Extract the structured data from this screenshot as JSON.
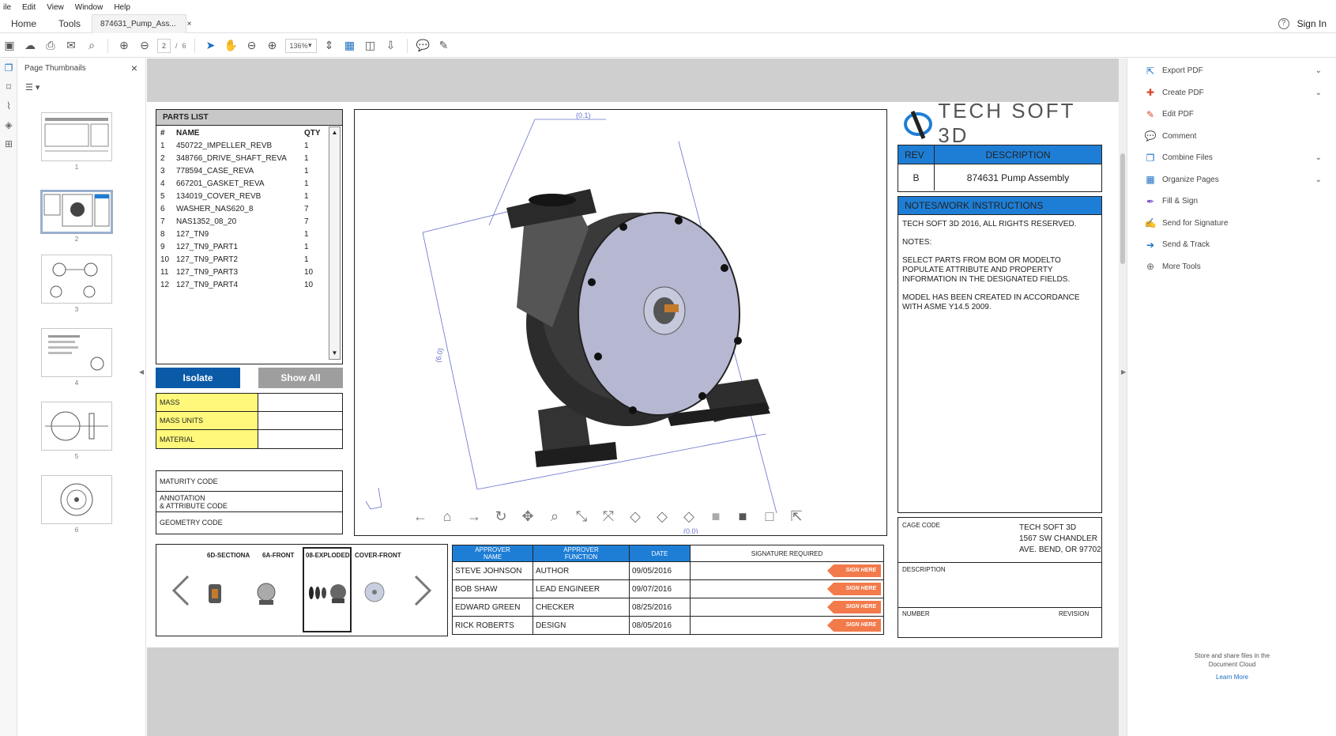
{
  "menu": [
    "ile",
    "Edit",
    "View",
    "Window",
    "Help"
  ],
  "tabs": {
    "home": "Home",
    "tools": "Tools",
    "doc": "874631_Pump_Ass...",
    "close": "×",
    "signin": "Sign In",
    "help": "?"
  },
  "toolbar": {
    "page_current": "2",
    "page_sep": "/",
    "page_total": "6",
    "zoom": "136%"
  },
  "thumbs": {
    "title": "Page Thumbnails",
    "close": "×",
    "pages": [
      "1",
      "2",
      "3",
      "4",
      "5",
      "6"
    ]
  },
  "right_tools": [
    {
      "label": "Export PDF",
      "icon": "export-pdf-icon",
      "chevron": true,
      "color": "#1a6fc2"
    },
    {
      "label": "Create PDF",
      "icon": "create-pdf-icon",
      "chevron": true,
      "color": "#d9472b"
    },
    {
      "label": "Edit PDF",
      "icon": "edit-pdf-icon",
      "chevron": false,
      "color": "#d9472b"
    },
    {
      "label": "Comment",
      "icon": "comment-icon",
      "chevron": false,
      "color": "#f2c200"
    },
    {
      "label": "Combine Files",
      "icon": "combine-files-icon",
      "chevron": true,
      "color": "#1a6fc2"
    },
    {
      "label": "Organize Pages",
      "icon": "organize-pages-icon",
      "chevron": true,
      "color": "#1a6fc2"
    },
    {
      "label": "Fill & Sign",
      "icon": "fill-sign-icon",
      "chevron": false,
      "color": "#7a4fc7"
    },
    {
      "label": "Send for Signature",
      "icon": "send-signature-icon",
      "chevron": false,
      "color": "#7a4fc7"
    },
    {
      "label": "Send & Track",
      "icon": "send-track-icon",
      "chevron": false,
      "color": "#1a6fc2"
    },
    {
      "label": "More Tools",
      "icon": "more-tools-icon",
      "chevron": false,
      "color": "#666666"
    }
  ],
  "right_footer": {
    "line1": "Store and share files in the",
    "line2": "Document Cloud",
    "link": "Learn More"
  },
  "doc": {
    "parts_title": "PARTS LIST",
    "parts_headers": {
      "num": "#",
      "name": "NAME",
      "qty": "QTY"
    },
    "parts": [
      {
        "num": "1",
        "name": "450722_IMPELLER_REVB",
        "qty": "1"
      },
      {
        "num": "2",
        "name": "348766_DRIVE_SHAFT_REVA",
        "qty": "1"
      },
      {
        "num": "3",
        "name": "778594_CASE_REVA",
        "qty": "1"
      },
      {
        "num": "4",
        "name": "667201_GASKET_REVA",
        "qty": "1"
      },
      {
        "num": "5",
        "name": "134019_COVER_REVB",
        "qty": "1"
      },
      {
        "num": "6",
        "name": "WASHER_NAS620_8",
        "qty": "7"
      },
      {
        "num": "7",
        "name": "NAS1352_08_20",
        "qty": "7"
      },
      {
        "num": "8",
        "name": "127_TN9",
        "qty": "1"
      },
      {
        "num": "9",
        "name": "127_TN9_PART1",
        "qty": "1"
      },
      {
        "num": "10",
        "name": "127_TN9_PART2",
        "qty": "1"
      },
      {
        "num": "11",
        "name": "127_TN9_PART3",
        "qty": "10"
      },
      {
        "num": "12",
        "name": "127_TN9_PART4",
        "qty": "10"
      }
    ],
    "isolate": "Isolate",
    "show_all": "Show All",
    "props": [
      "MASS",
      "MASS UNITS",
      "MATERIAL"
    ],
    "codes": {
      "maturity": "MATURITY CODE",
      "annotation": "ANNOTATION\n& ATTRIBUTE CODE",
      "geometry": "GEOMETRY CODE"
    },
    "views": [
      "6D-SECTIONA",
      "6A-FRONT",
      "08-EXPLODED",
      "COVER-FRONT"
    ],
    "dims": {
      "top": "(0.1)",
      "left": "(6.0)",
      "bottom": "(0.0)"
    },
    "logo_text": "TECH SOFT 3D",
    "rev_header": "REV",
    "desc_header": "DESCRIPTION",
    "rev": "B",
    "description": "874631 Pump Assembly",
    "notes_header": "NOTES/WORK INSTRUCTIONS",
    "notes": [
      "TECH SOFT 3D 2016, ALL RIGHTS RESERVED.",
      "NOTES:",
      "SELECT PARTS  FROM BOM OR MODELTO\nPOPULATE ATTRIBUTE AND PROPERTY\nINFORMATION IN THE DESIGNATED FIELDS.",
      "MODEL HAS BEEN CREATED IN ACCORDANCE\nWITH ASME Y14.5 2009."
    ],
    "approval_headers": {
      "name": "APPROVER\nNAME",
      "function": "APPROVER\nFUNCTION",
      "date": "DATE",
      "sig": "SIGNATURE REQUIRED"
    },
    "approvers": [
      {
        "name": "STEVE JOHNSON",
        "function": "AUTHOR",
        "date": "09/05/2016",
        "sign": "SIGN HERE"
      },
      {
        "name": "BOB SHAW",
        "function": "LEAD ENGINEER",
        "date": "09/07/2016",
        "sign": "SIGN HERE"
      },
      {
        "name": "EDWARD GREEN",
        "function": "CHECKER",
        "date": "08/25/2016",
        "sign": "SIGN HERE"
      },
      {
        "name": "RICK ROBERTS",
        "function": "DESIGN",
        "date": "08/05/2016",
        "sign": "SIGN HERE"
      }
    ],
    "cage": {
      "label": "CAGE CODE",
      "line1": "TECH SOFT 3D",
      "line2": "1567 SW CHANDLER",
      "line3": "AVE. BEND, OR 97702"
    },
    "title_block": {
      "description": "DESCRIPTION",
      "number": "NUMBER",
      "revision": "REVISION"
    }
  }
}
